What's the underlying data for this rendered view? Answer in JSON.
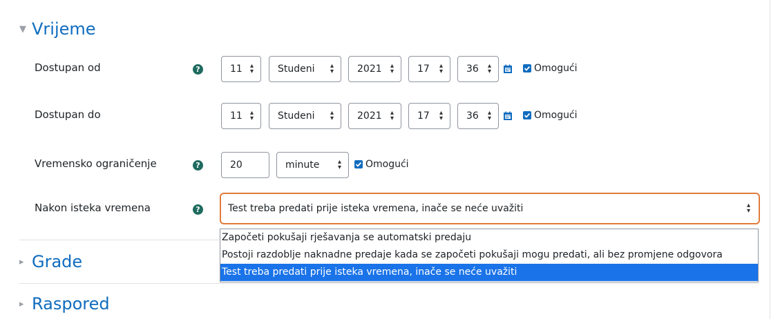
{
  "sections": {
    "vrijeme": "Vrijeme",
    "grade": "Grade",
    "raspored": "Raspored"
  },
  "rows": {
    "dostupan_od": {
      "label": "Dostupan od",
      "day": "11",
      "month": "Studeni",
      "year": "2021",
      "hour": "17",
      "minute": "36",
      "enable": "Omogući"
    },
    "dostupan_do": {
      "label": "Dostupan do",
      "day": "11",
      "month": "Studeni",
      "year": "2021",
      "hour": "17",
      "minute": "36",
      "enable": "Omogući"
    },
    "vremensko": {
      "label": "Vremensko ograničenje",
      "value": "20",
      "unit": "minute",
      "enable": "Omogući"
    },
    "nakon": {
      "label": "Nakon isteka vremena",
      "selected": "Test treba predati prije isteka vremena, inače se neće uvažiti",
      "options": [
        "Započeti pokušaji rješavanja se automatski predaju",
        "Postoji razdoblje naknadne predaje kada se započeti pokušaji mogu predati, ali bez promjene odgovora",
        "Test treba predati prije isteka vremena, inače se neće uvažiti"
      ]
    }
  },
  "colors": {
    "accent": "#0f6cbf",
    "focus": "#e07b39",
    "highlight": "#1a73e8",
    "help": "#1f6b5f"
  }
}
